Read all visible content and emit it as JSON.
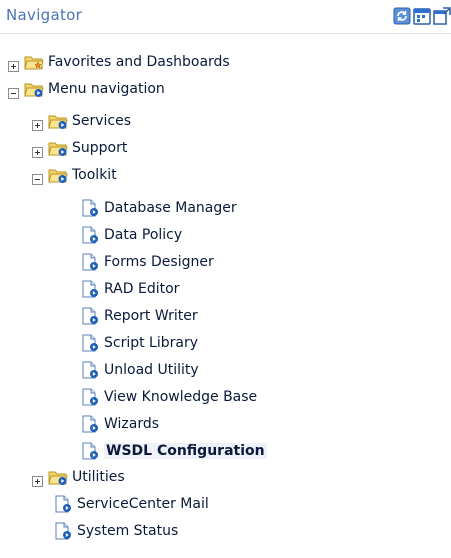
{
  "header": {
    "title": "Navigator",
    "icons": [
      "refresh-icon",
      "calendar-icon",
      "detach-window-icon"
    ]
  },
  "tree": {
    "favorites": {
      "label": "Favorites and Dashboards",
      "icon": "favorites-folder-icon",
      "state": "collapsed"
    },
    "menu_navigation": {
      "label": "Menu navigation",
      "icon": "menu-folder-icon",
      "state": "expanded"
    },
    "services": {
      "label": "Services",
      "icon": "folder-icon",
      "state": "collapsed"
    },
    "support": {
      "label": "Support",
      "icon": "folder-icon",
      "state": "collapsed"
    },
    "toolkit": {
      "label": "Toolkit",
      "icon": "folder-icon",
      "state": "expanded"
    },
    "toolkit_items": [
      "Database Manager",
      "Data Policy",
      "Forms Designer",
      "RAD Editor",
      "Report Writer",
      "Script Library",
      "Unload Utility",
      "View Knowledge Base",
      "Wizards",
      "WSDL Configuration"
    ],
    "selected_item": "WSDL Configuration",
    "utilities": {
      "label": "Utilities",
      "icon": "folder-icon",
      "state": "collapsed"
    },
    "servicecenter_mail": {
      "label": "ServiceCenter Mail",
      "icon": "document-icon"
    },
    "system_status": {
      "label": "System Status",
      "icon": "document-icon"
    }
  },
  "colors": {
    "header_text": "#4a74b6",
    "item_text": "#0b1a3a",
    "folder": "#e8c34a",
    "doc_badge": "#1f5fb8"
  }
}
